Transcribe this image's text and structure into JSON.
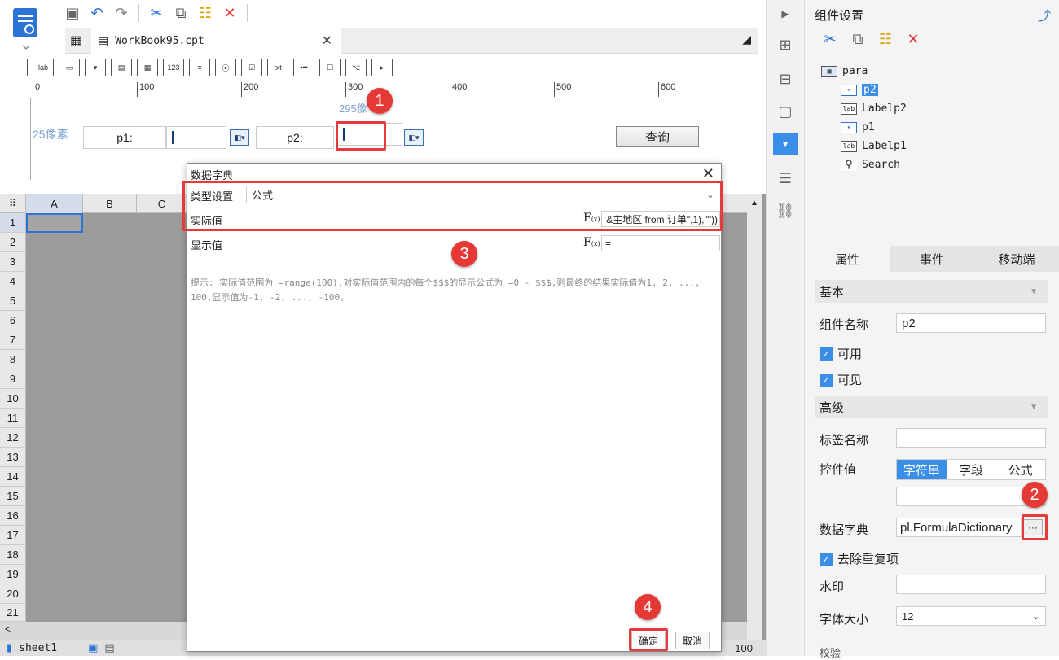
{
  "file_tab": {
    "name": "WorkBook95.cpt"
  },
  "ruler_ticks": [
    "0",
    "100",
    "200",
    "300",
    "400",
    "500",
    "600"
  ],
  "design": {
    "size_hint_top": "295像",
    "size_hint_left": "25像素",
    "p1_label": "p1:",
    "p2_label": "p2:",
    "query_button": "查询"
  },
  "grid": {
    "columns": [
      "A",
      "B",
      "C"
    ],
    "rows": [
      "1",
      "2",
      "3",
      "4",
      "5",
      "6",
      "7",
      "8",
      "9",
      "10",
      "11",
      "12",
      "13",
      "14",
      "15",
      "16",
      "17",
      "18",
      "19",
      "20",
      "21"
    ],
    "sheet_tab": "sheet1",
    "zoom": "100"
  },
  "dialog": {
    "title": "数据字典",
    "type_label": "类型设置",
    "type_value": "公式",
    "actual_label": "实际值",
    "actual_formula": "&主地区 from 订单\",1),\"\"))",
    "display_label": "显示值",
    "display_formula": "=",
    "hint": "提示: 实际值范围为 =range(100),对实际值范围内的每个$$$的显示公式为 =0 - $$$,则最终的结果实际值为1, 2, ..., 100,显示值为-1, -2, ..., -100。",
    "ok": "确定",
    "cancel": "取消"
  },
  "right_panel": {
    "title": "组件设置",
    "tree": [
      {
        "label": "para",
        "icon": "para-icon"
      },
      {
        "label": "p2",
        "icon": "combobox-icon",
        "selected": true
      },
      {
        "label": "Labelp2",
        "icon": "label-icon"
      },
      {
        "label": "p1",
        "icon": "combobox-icon"
      },
      {
        "label": "Labelp1",
        "icon": "label-icon"
      },
      {
        "label": "Search",
        "icon": "search-icon"
      }
    ],
    "tabs": [
      "属性",
      "事件",
      "移动端"
    ],
    "basic": {
      "header": "基本",
      "name_label": "组件名称",
      "name_value": "p2",
      "enabled": "可用",
      "visible": "可见"
    },
    "advanced": {
      "header": "高级",
      "tag_label": "标签名称",
      "value_label": "控件值",
      "value_options": [
        "字符串",
        "字段",
        "公式"
      ],
      "dict_label": "数据字典",
      "dict_value": "pl.FormulaDictionary",
      "dedupe": "去除重复项",
      "watermark_label": "水印",
      "font_size_label": "字体大小",
      "font_size_value": "12",
      "check_label": "校验"
    }
  },
  "annotations": [
    "1",
    "2",
    "3",
    "4"
  ],
  "colors": {
    "accent": "#3b8ee8",
    "annotation_red": "#e53935"
  }
}
